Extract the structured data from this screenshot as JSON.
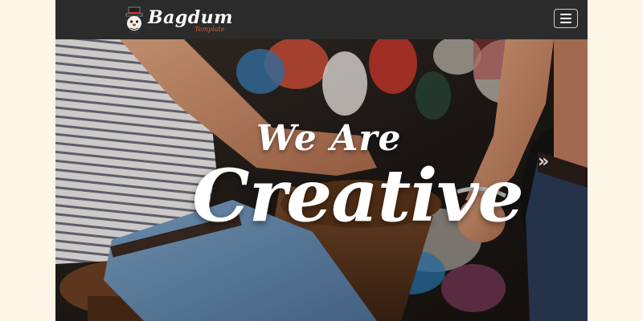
{
  "brand": {
    "name": "Bagdum",
    "tagline": "Template"
  },
  "nav": {
    "menu_icon": "hamburger-menu-icon"
  },
  "hero": {
    "line1": "We Are",
    "line2": "Creative",
    "next_icon": "double-chevron-right-icon",
    "next_glyph": "»"
  },
  "colors": {
    "page_background": "#fdf5e6",
    "navbar": "#2b2b2b",
    "tagline": "#e05a2a",
    "headline": "#ffffff"
  }
}
